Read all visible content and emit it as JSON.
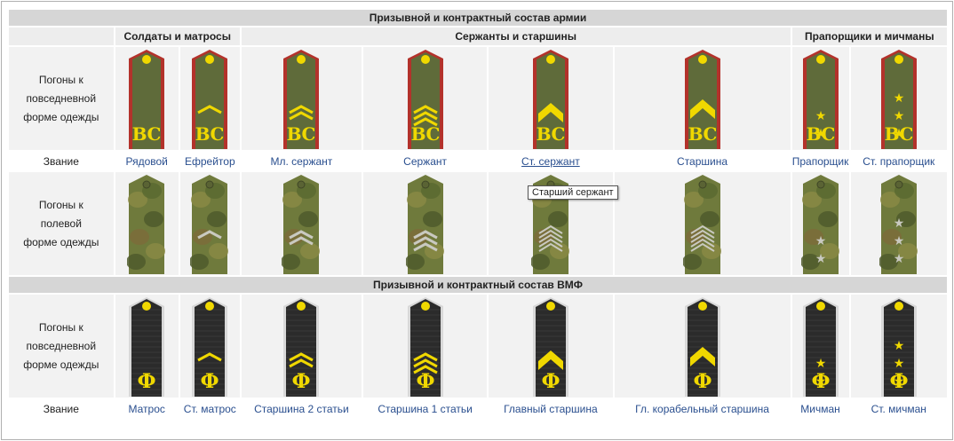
{
  "army": {
    "title": "Призывной и контрактный состав армии",
    "groups": [
      "Солдаты и матросы",
      "Сержанты и старшины",
      "Прапорщики и мичманы"
    ],
    "daily_label": [
      "Погоны к",
      "повседневной",
      "форме одежды"
    ],
    "field_label": [
      "Погоны к",
      "полевой",
      "форме одежды"
    ],
    "rank_label": "Звание",
    "ranks": [
      "Рядовой",
      "Ефрейтор",
      "Мл. сержант",
      "Сержант",
      "Ст. сержант",
      "Старшина",
      "Прапорщик",
      "Ст. прапорщик"
    ],
    "board_text": "ВС"
  },
  "navy": {
    "title": "Призывной и контрактный состав ВМФ",
    "daily_label": [
      "Погоны к",
      "повседневной",
      "форме одежды"
    ],
    "rank_label": "Звание",
    "ranks": [
      "Матрос",
      "Ст. матрос",
      "Старшина 2 статьи",
      "Старшина 1 статьи",
      "Главный старшина",
      "Гл. корабельный старшина",
      "Мичман",
      "Ст. мичман"
    ],
    "board_text": "Ф"
  },
  "tooltip": "Старший сержант",
  "colors": {
    "army_board": "#5f6b3a",
    "army_piping": "#b3322b",
    "insignia_yellow": "#f0d800",
    "navy_board": "#2b2b2b",
    "navy_piping": "#d8d8d8",
    "link": "#2a4f8f",
    "header_bg": "#d6d6d6",
    "cell_bg": "#f2f2f2"
  }
}
